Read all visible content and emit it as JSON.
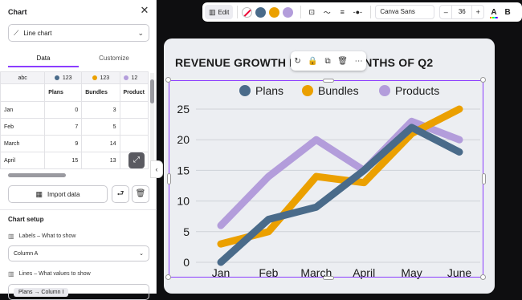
{
  "panel": {
    "title": "Chart",
    "chart_type": "Line chart",
    "tabs": [
      "Data",
      "Customize"
    ],
    "grid": {
      "header": [
        {
          "label": "abc",
          "color": ""
        },
        {
          "label": "123",
          "color": "#4a6b8a"
        },
        {
          "label": "123",
          "color": "#eba000"
        },
        {
          "label": "12",
          "color": "#b39ddb"
        }
      ],
      "subheader": [
        "",
        "Plans",
        "Bundles",
        "Product"
      ],
      "rows": [
        [
          "Jan",
          "0",
          "3",
          ""
        ],
        [
          "Feb",
          "7",
          "5",
          ""
        ],
        [
          "March",
          "9",
          "14",
          ""
        ],
        [
          "April",
          "15",
          "13",
          ""
        ],
        [
          "",
          "",
          "",
          ""
        ]
      ]
    },
    "import_label": "Import data",
    "setup_title": "Chart setup",
    "labels_row": "Labels – What to show",
    "labels_select": "Column A",
    "lines_row": "Lines – What values to show",
    "lines_select": "Plans → Column I"
  },
  "toolbar": {
    "edit_label": "Edit",
    "colors": [
      "#4a6b8a",
      "#eba000",
      "#b39ddb"
    ],
    "font": "Canva Sans",
    "size_minus": "–",
    "font_size": "36",
    "size_plus": "+",
    "text_color": "A",
    "bold": "B"
  },
  "chart_title": "REVENUE GROWTH LA",
  "chart_title_tail": "NTHS OF Q2",
  "chart_data": {
    "type": "line",
    "x": [
      "Jan",
      "Feb",
      "March",
      "April",
      "May",
      "June"
    ],
    "series": [
      {
        "name": "Plans",
        "color": "#4a6b8a",
        "values": [
          0,
          7,
          9,
          15,
          22,
          18
        ]
      },
      {
        "name": "Bundles",
        "color": "#eba000",
        "values": [
          3,
          5,
          14,
          13,
          21,
          25
        ]
      },
      {
        "name": "Products",
        "color": "#b39ddb",
        "values": [
          6,
          14,
          20,
          15,
          23,
          20
        ]
      }
    ],
    "yticks": [
      0,
      5,
      10,
      15,
      20,
      25
    ],
    "ylim": [
      0,
      25
    ],
    "grid": true,
    "legend": "top-center"
  }
}
